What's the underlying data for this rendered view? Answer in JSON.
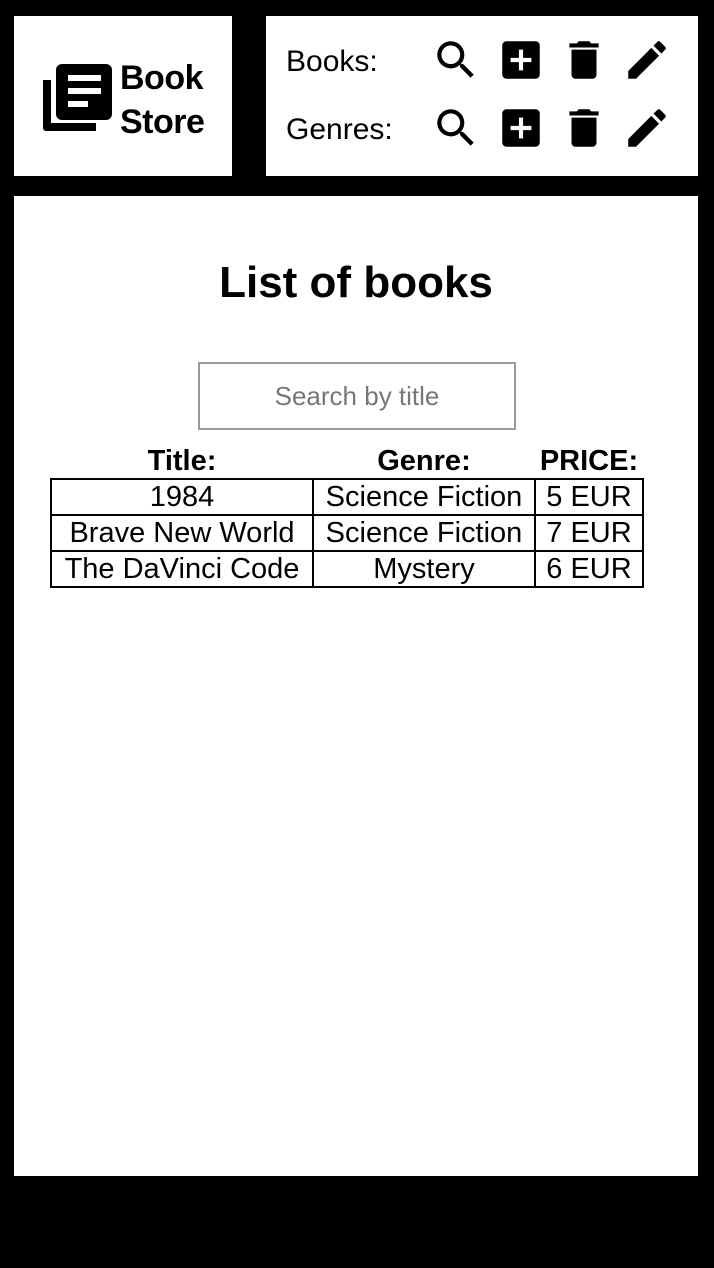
{
  "logo": {
    "line1": "Book",
    "line2": "Store"
  },
  "nav": [
    {
      "label": "Books:",
      "actions": [
        "search-icon",
        "plus-icon",
        "trash-icon",
        "pencil-icon"
      ]
    },
    {
      "label": "Genres:",
      "actions": [
        "search-icon",
        "plus-icon",
        "trash-icon",
        "pencil-icon"
      ]
    }
  ],
  "main": {
    "title": "List of books",
    "search_placeholder": "Search by title",
    "table": {
      "headers": [
        "Title:",
        "Genre:",
        "PRICE:"
      ],
      "rows": [
        [
          "1984",
          "Science Fiction",
          "5 EUR"
        ],
        [
          "Brave New World",
          "Science Fiction",
          "7 EUR"
        ],
        [
          "The DaVinci Code",
          "Mystery",
          "6 EUR"
        ]
      ]
    }
  },
  "colors": {
    "background": "#000000",
    "panel": "#ffffff",
    "input_border": "#9a9a9a"
  }
}
